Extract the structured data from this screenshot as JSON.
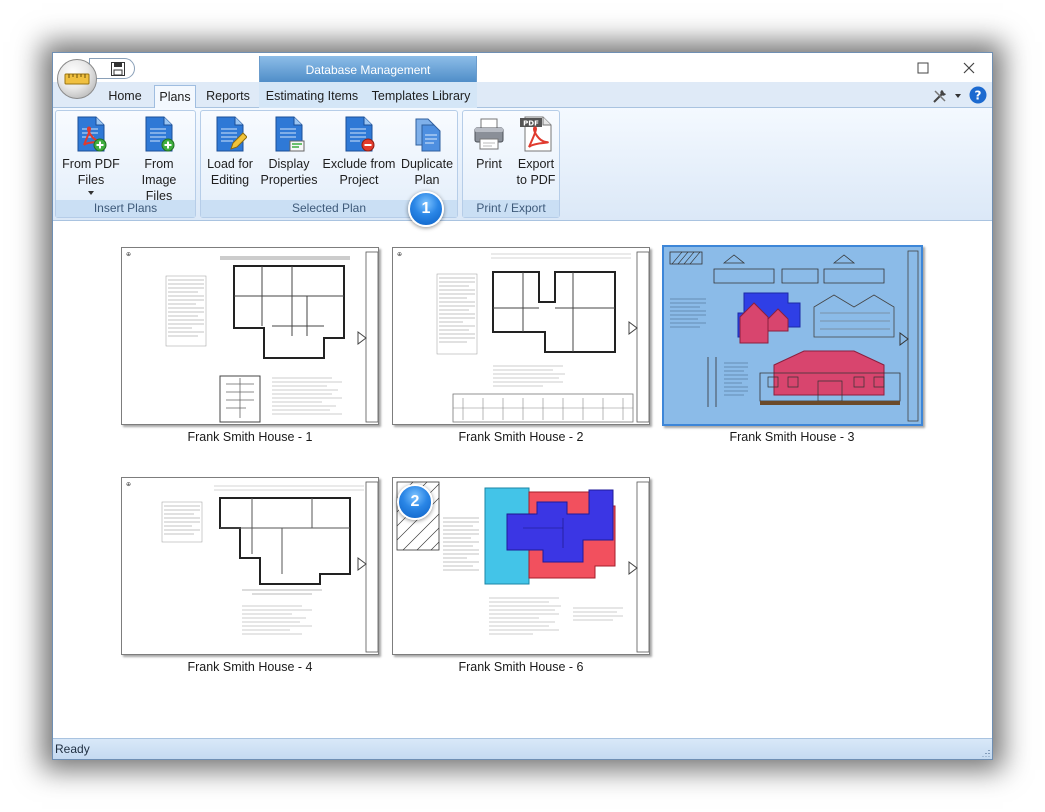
{
  "context_tab": "Database Management",
  "tabs": [
    "Home",
    "Plans",
    "Reports",
    "Estimating Items",
    "Templates Library"
  ],
  "active_tab": "Plans",
  "groups": {
    "insert": {
      "label": "Insert Plans",
      "btn1": {
        "line1": "From PDF",
        "line2": "Files"
      },
      "btn2": {
        "line1": "From Image",
        "line2": "Files"
      }
    },
    "selected": {
      "label": "Selected Plan",
      "btn1": {
        "line1": "Load for",
        "line2": "Editing"
      },
      "btn2": {
        "line1": "Display",
        "line2": "Properties"
      },
      "btn3": {
        "line1": "Exclude from",
        "line2": "Project"
      },
      "btn4": {
        "line1": "Duplicate",
        "line2": "Plan"
      }
    },
    "print": {
      "label": "Print / Export",
      "btn1": {
        "line1": "Print"
      },
      "btn2": {
        "line1": "Export",
        "line2": "to PDF"
      }
    }
  },
  "pdf_badge": "PDF",
  "callouts": [
    "1",
    "2"
  ],
  "plans": [
    {
      "name": "Frank Smith House - 1"
    },
    {
      "name": "Frank Smith House - 2"
    },
    {
      "name": "Frank Smith House - 3",
      "selected": true
    },
    {
      "name": "Frank Smith House - 4"
    },
    {
      "name": "Frank Smith House - 6"
    }
  ],
  "status": "Ready",
  "colors": {
    "accent": "#3d86d8",
    "selection_fill": "#7fb2e5",
    "area_blue": "#3a35e0",
    "area_red": "#f24c5a",
    "area_cyan": "#40c4e6"
  }
}
